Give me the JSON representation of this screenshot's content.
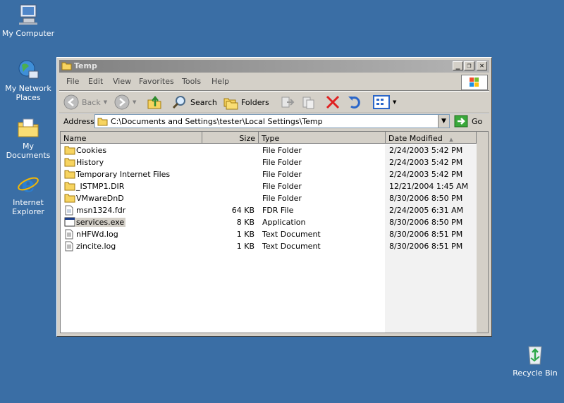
{
  "desktop": {
    "icons": [
      {
        "label": "My Computer"
      },
      {
        "label": "My Network Places"
      },
      {
        "label": "My Documents"
      },
      {
        "label": "Internet Explorer"
      },
      {
        "label": "Recycle Bin"
      }
    ]
  },
  "window": {
    "title": "Temp",
    "menu": [
      "File",
      "Edit",
      "View",
      "Favorites",
      "Tools",
      "Help"
    ],
    "toolbar": {
      "back": "Back",
      "search": "Search",
      "folders": "Folders"
    },
    "address": {
      "label": "Address",
      "value": "C:\\Documents and Settings\\tester\\Local Settings\\Temp",
      "go": "Go"
    }
  },
  "columns": {
    "name": "Name",
    "size": "Size",
    "type": "Type",
    "date": "Date Modified"
  },
  "files": [
    {
      "name": "Cookies",
      "size": "",
      "type": "File Folder",
      "date": "2/24/2003 5:42 PM",
      "icon": "folder"
    },
    {
      "name": "History",
      "size": "",
      "type": "File Folder",
      "date": "2/24/2003 5:42 PM",
      "icon": "folder"
    },
    {
      "name": "Temporary Internet Files",
      "size": "",
      "type": "File Folder",
      "date": "2/24/2003 5:42 PM",
      "icon": "folder"
    },
    {
      "name": "_ISTMP1.DIR",
      "size": "",
      "type": "File Folder",
      "date": "12/21/2004 1:45 AM",
      "icon": "folder"
    },
    {
      "name": "VMwareDnD",
      "size": "",
      "type": "File Folder",
      "date": "8/30/2006 8:50 PM",
      "icon": "folder"
    },
    {
      "name": "msn1324.fdr",
      "size": "64 KB",
      "type": "FDR File",
      "date": "2/24/2005 6:31 AM",
      "icon": "file"
    },
    {
      "name": "services.exe",
      "size": "8 KB",
      "type": "Application",
      "date": "8/30/2006 8:50 PM",
      "icon": "app"
    },
    {
      "name": "nHFWd.log",
      "size": "1 KB",
      "type": "Text Document",
      "date": "8/30/2006 8:51 PM",
      "icon": "text"
    },
    {
      "name": "zincite.log",
      "size": "1 KB",
      "type": "Text Document",
      "date": "8/30/2006 8:51 PM",
      "icon": "text"
    }
  ],
  "colors": {
    "desktop": "#3a6ea5",
    "folder": "#f7d460"
  }
}
